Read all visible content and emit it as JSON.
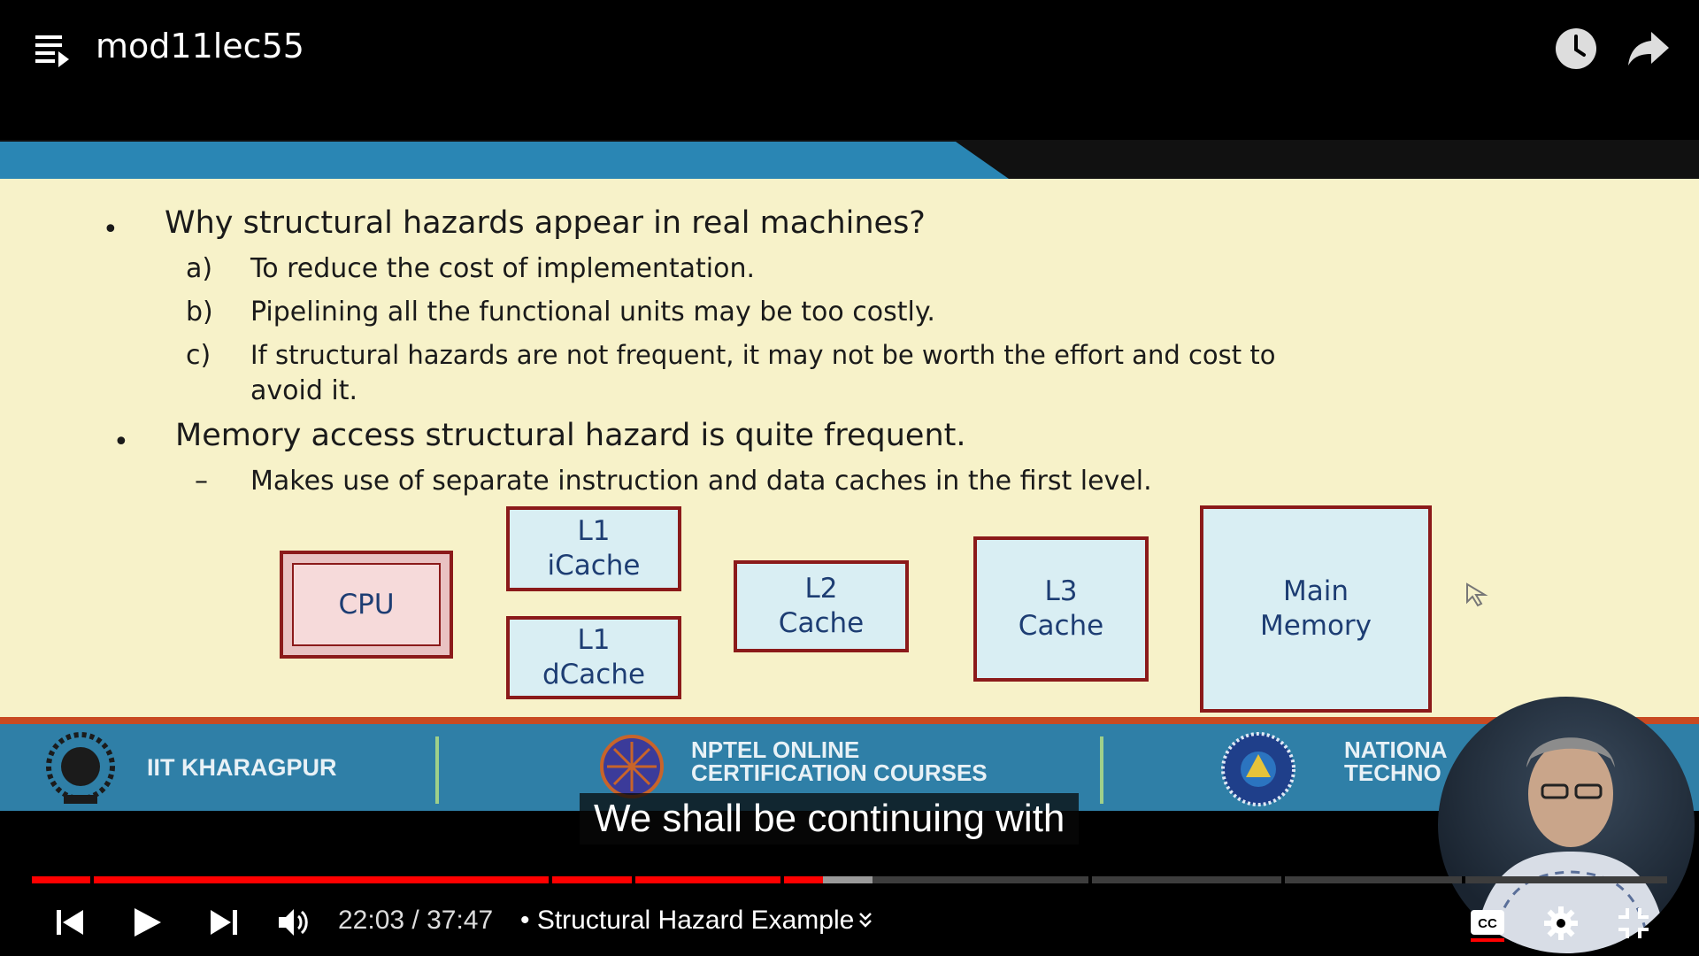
{
  "header": {
    "title": "mod11lec55",
    "icons": [
      "playlist-icon",
      "watch-later-icon",
      "share-icon"
    ]
  },
  "slide": {
    "bullets": [
      {
        "text": "Why structural hazards appear in real machines?",
        "subitems": [
          {
            "marker": "a)",
            "text": "To reduce the cost of implementation."
          },
          {
            "marker": "b)",
            "text": "Pipelining all the functional units may be too costly."
          },
          {
            "marker": "c)",
            "text": "If structural hazards are not frequent, it may not be worth the effort and cost to",
            "continuation": "avoid it."
          }
        ]
      },
      {
        "text": "Memory access structural hazard is quite frequent.",
        "subitems": [
          {
            "marker": "–",
            "text": "Makes use of separate instruction and data caches in the first level."
          }
        ]
      }
    ],
    "boxes": {
      "cpu": "CPU",
      "l1i": "L1\niCache",
      "l1d": "L1\ndCache",
      "l2": "L2\nCache",
      "l3": "L3\nCache",
      "mem": "Main\nMemory"
    },
    "footer": {
      "left": "IIT KHARAGPUR",
      "center_line1": "NPTEL ONLINE",
      "center_line2": "CERTIFICATION COURSES",
      "right_line1": "NATIONA",
      "right_line2": "TECHNO"
    },
    "colors": {
      "slide_bg": "#f7f2c9",
      "header_bar": "#2a86b4",
      "footer_bg": "#2f7fa7",
      "box_border": "#8b1a1a",
      "box_fill": "#d9eef3",
      "box_text": "#1d3d73"
    }
  },
  "caption": "We shall be continuing with",
  "player": {
    "current_time": "22:03",
    "duration": "37:47",
    "time_display": "22:03 / 37:47",
    "chapter": "• Structural Hazard Example",
    "progress_played_fraction": 0.484,
    "progress_buffered_fraction": 0.514,
    "colors": {
      "played": "#ff0000",
      "buffered": "#9a9a9a",
      "unplayed": "#3d3d3d"
    },
    "icons": [
      "previous-icon",
      "play-icon",
      "next-icon",
      "volume-icon",
      "captions-icon",
      "settings-icon",
      "exit-fullscreen-icon"
    ]
  }
}
